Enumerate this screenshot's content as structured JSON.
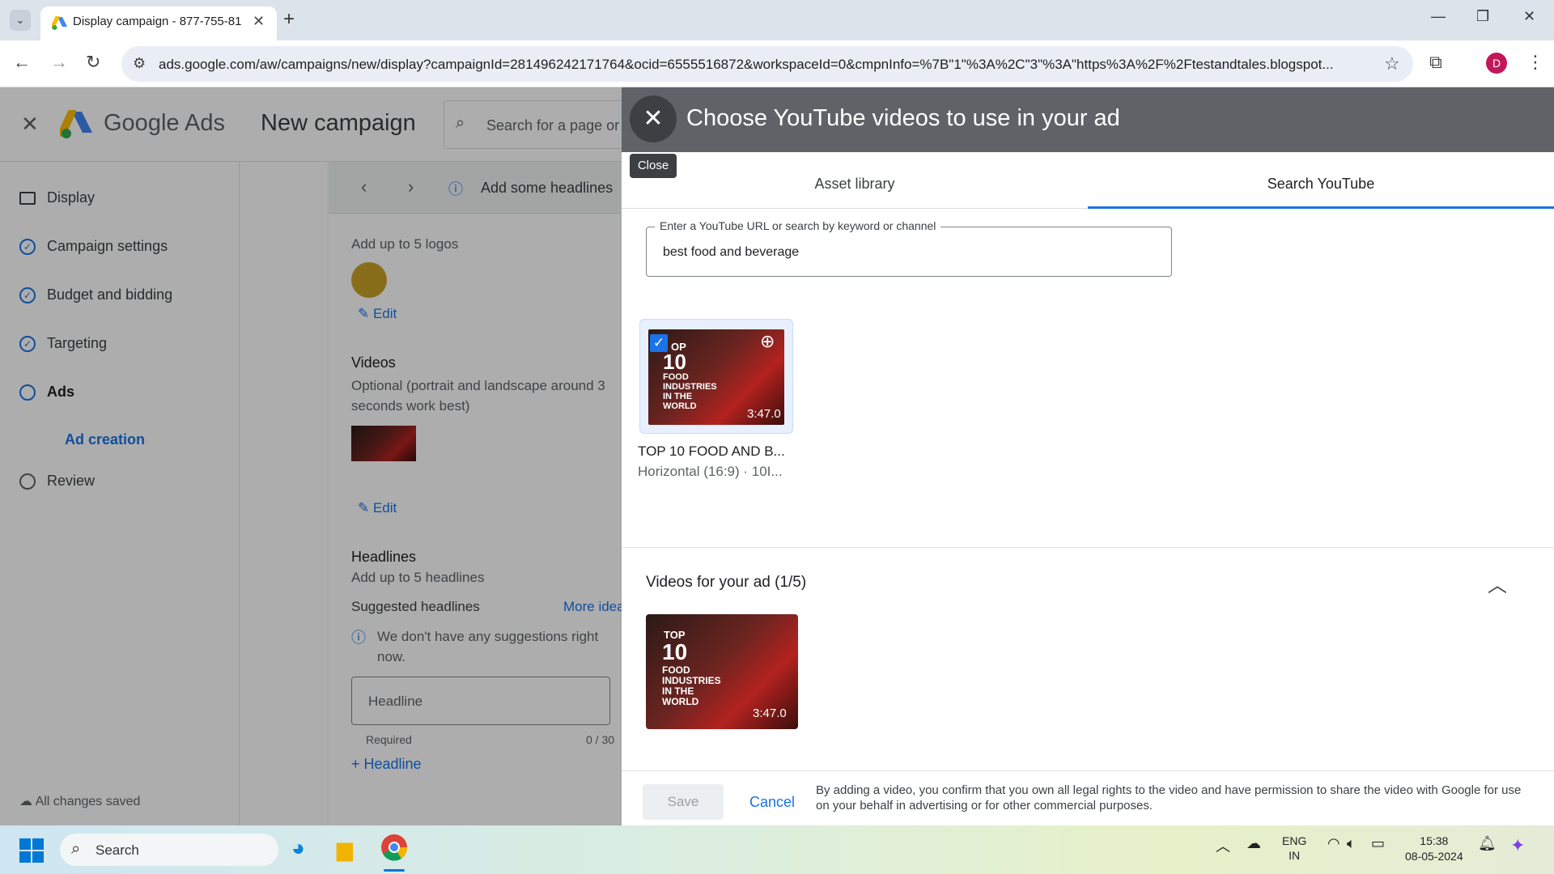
{
  "browser": {
    "tab_title": "Display campaign - 877-755-81",
    "url": "ads.google.com/aw/campaigns/new/display?campaignId=281496242171764&ocid=6555516872&workspaceId=0&cmpnInfo=%7B\"1\"%3A%2C\"3\"%3A\"https%3A%2F%2Ftestandtales.blogspot...",
    "profile_initial": "D"
  },
  "app": {
    "product_name": "Google Ads",
    "page_title": "New campaign",
    "search_placeholder": "Search for a page or",
    "nav": [
      {
        "label": "Display"
      },
      {
        "label": "Campaign settings"
      },
      {
        "label": "Budget and bidding"
      },
      {
        "label": "Targeting"
      },
      {
        "label": "Ads"
      },
      {
        "label": "Ad creation"
      },
      {
        "label": "Review"
      }
    ],
    "save_status": "All changes saved",
    "steps_hint": "Add some headlines",
    "logos_hint": "Add up to 5 logos",
    "edit_label": "Edit",
    "videos_heading": "Videos",
    "videos_hint": "Optional (portrait and landscape around 3 seconds work best)",
    "headlines_heading": "Headlines",
    "headlines_hint": "Add up to 5 headlines",
    "suggested_label": "Suggested headlines",
    "more_ideas": "More ideas",
    "no_suggestions": "We don't have any suggestions right now.",
    "headline_placeholder": "Headline",
    "required_label": "Required",
    "char_count": "0 / 30",
    "add_headline": "Headline"
  },
  "dialog": {
    "title": "Choose YouTube videos to use in your ad",
    "close_tooltip": "Close",
    "tabs": [
      "Asset library",
      "Search YouTube"
    ],
    "search_label": "Enter a YouTube URL or search by keyword or channel",
    "search_value": "best food and beverage",
    "result": {
      "thumb_lines": [
        "OP",
        "10",
        "FOOD",
        "INDUSTRIES",
        "IN THE",
        "WORLD"
      ],
      "duration": "3:47.0",
      "title": "TOP 10 FOOD AND B...",
      "meta": "Horizontal (16:9) · 10I..."
    },
    "selected_heading": "Videos for your ad (1/5)",
    "selected": {
      "thumb_lines": [
        "TOP",
        "10",
        "FOOD",
        "INDUSTRIES",
        "IN THE",
        "WORLD"
      ],
      "duration": "3:47.0"
    },
    "save_label": "Save",
    "cancel_label": "Cancel",
    "legal": "By adding a video, you confirm that you own all legal rights to the video and have permission to share the video with Google for use on your behalf in advertising or for other commercial purposes."
  },
  "taskbar": {
    "search_label": "Search",
    "lang_line1": "ENG",
    "lang_line2": "IN",
    "time": "15:38",
    "date": "08-05-2024"
  },
  "colors": {
    "accent": "#1a73e8",
    "dialog_header": "#5f6368"
  }
}
